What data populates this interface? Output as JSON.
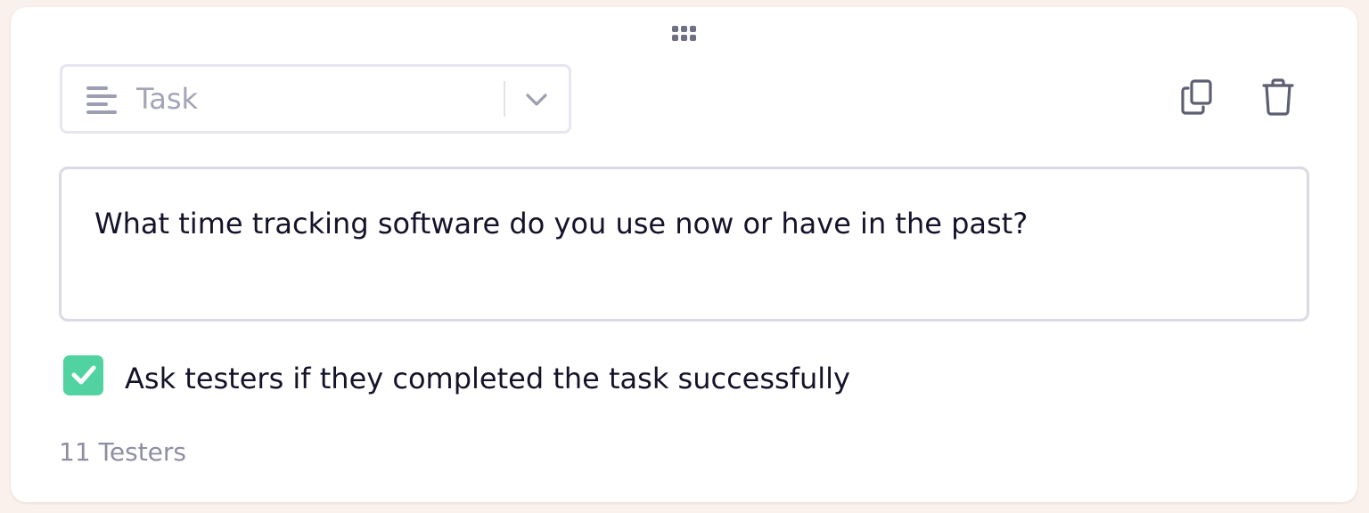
{
  "block": {
    "type_select": {
      "selected_value": "Task",
      "icon": "align-left-icon",
      "dropdown_icon": "chevron-down-icon"
    },
    "actions": {
      "duplicate_icon": "copy-icon",
      "delete_icon": "trash-icon"
    },
    "drag_handle_icon": "grip-dots-icon",
    "question": {
      "value": "What time tracking software do you use now or have in the past?"
    },
    "completion_check": {
      "checked": true,
      "label": "Ask testers if they completed the task successfully"
    },
    "testers_count_label": "11 Testers"
  },
  "colors": {
    "page_background": "#fbf1ec",
    "card_background": "#ffffff",
    "checkbox_accent": "#50d3a0",
    "primary_text": "#151329",
    "muted_text": "#8e8ea2",
    "icon_gray": "#5d5f72",
    "border": "#d9dae4"
  }
}
